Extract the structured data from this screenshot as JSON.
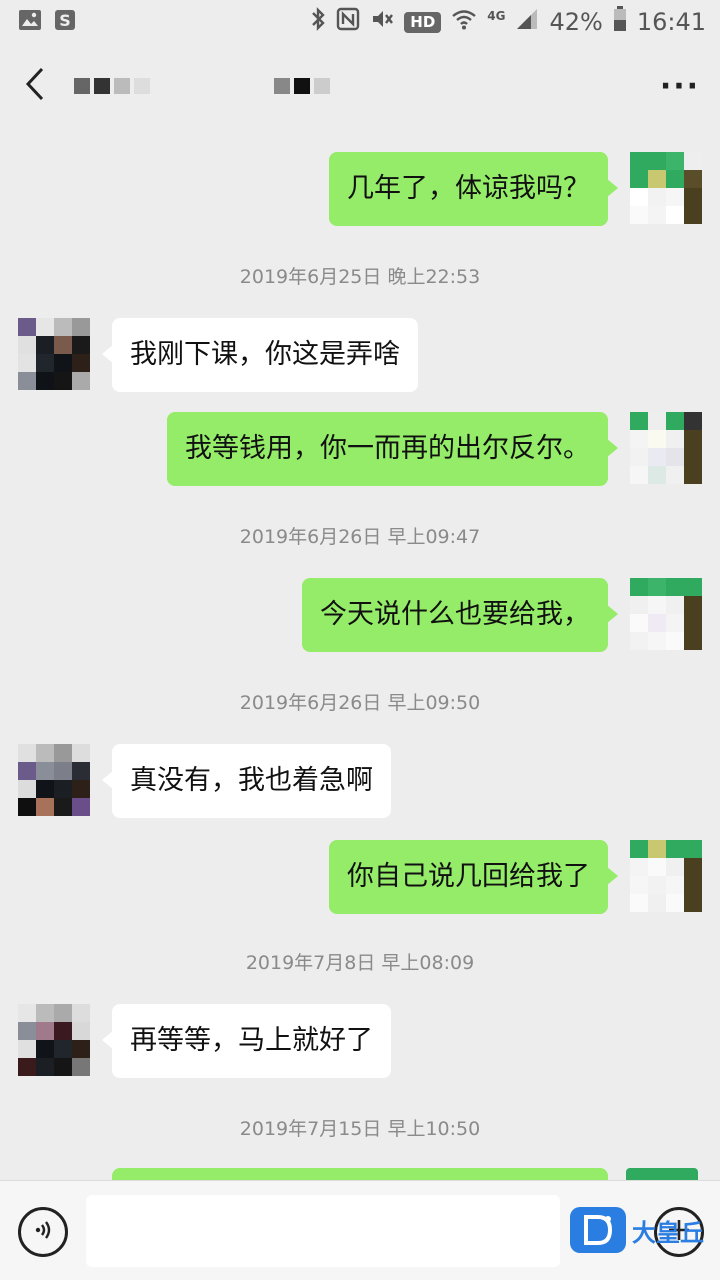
{
  "status_bar": {
    "hd": "HD",
    "network": "4G",
    "battery": "42%",
    "time": "16:41",
    "icons": [
      "gallery-icon",
      "s-app-icon",
      "bluetooth-icon",
      "nfc-icon",
      "mute-icon",
      "wifi-icon",
      "signal-icon",
      "battery-icon"
    ]
  },
  "nav": {
    "back_icon": "chevron-left-icon",
    "more_label": "···",
    "title_pixelated": true
  },
  "messages": [
    {
      "type": "message",
      "side": "me",
      "text": "几年了，体谅我吗？"
    },
    {
      "type": "timestamp",
      "text": "2019年6月25日 晚上22:53"
    },
    {
      "type": "message",
      "side": "them",
      "text": "我刚下课，你这是弄啥"
    },
    {
      "type": "message",
      "side": "me",
      "text": "我等钱用，你一而再的出尔反尔。"
    },
    {
      "type": "timestamp",
      "text": "2019年6月26日 早上09:47"
    },
    {
      "type": "message",
      "side": "me",
      "text": "今天说什么也要给我，"
    },
    {
      "type": "timestamp",
      "text": "2019年6月26日 早上09:50"
    },
    {
      "type": "message",
      "side": "them",
      "text": "真没有，我也着急啊"
    },
    {
      "type": "message",
      "side": "me",
      "text": "你自己说几回给我了"
    },
    {
      "type": "timestamp",
      "text": "2019年7月8日 早上08:09"
    },
    {
      "type": "message",
      "side": "them",
      "text": "再等等，马上就好了"
    },
    {
      "type": "timestamp",
      "text": "2019年7月15日 早上10:50"
    }
  ],
  "input": {
    "voice_icon": "voice-icon",
    "placeholder": "",
    "plus_icon": "plus-icon"
  },
  "watermark": {
    "text": "大皇丘"
  },
  "colors": {
    "chat_bg": "#ededed",
    "my_bubble": "#95ec69",
    "their_bubble": "#ffffff",
    "timestamp": "#8a8a8a"
  }
}
